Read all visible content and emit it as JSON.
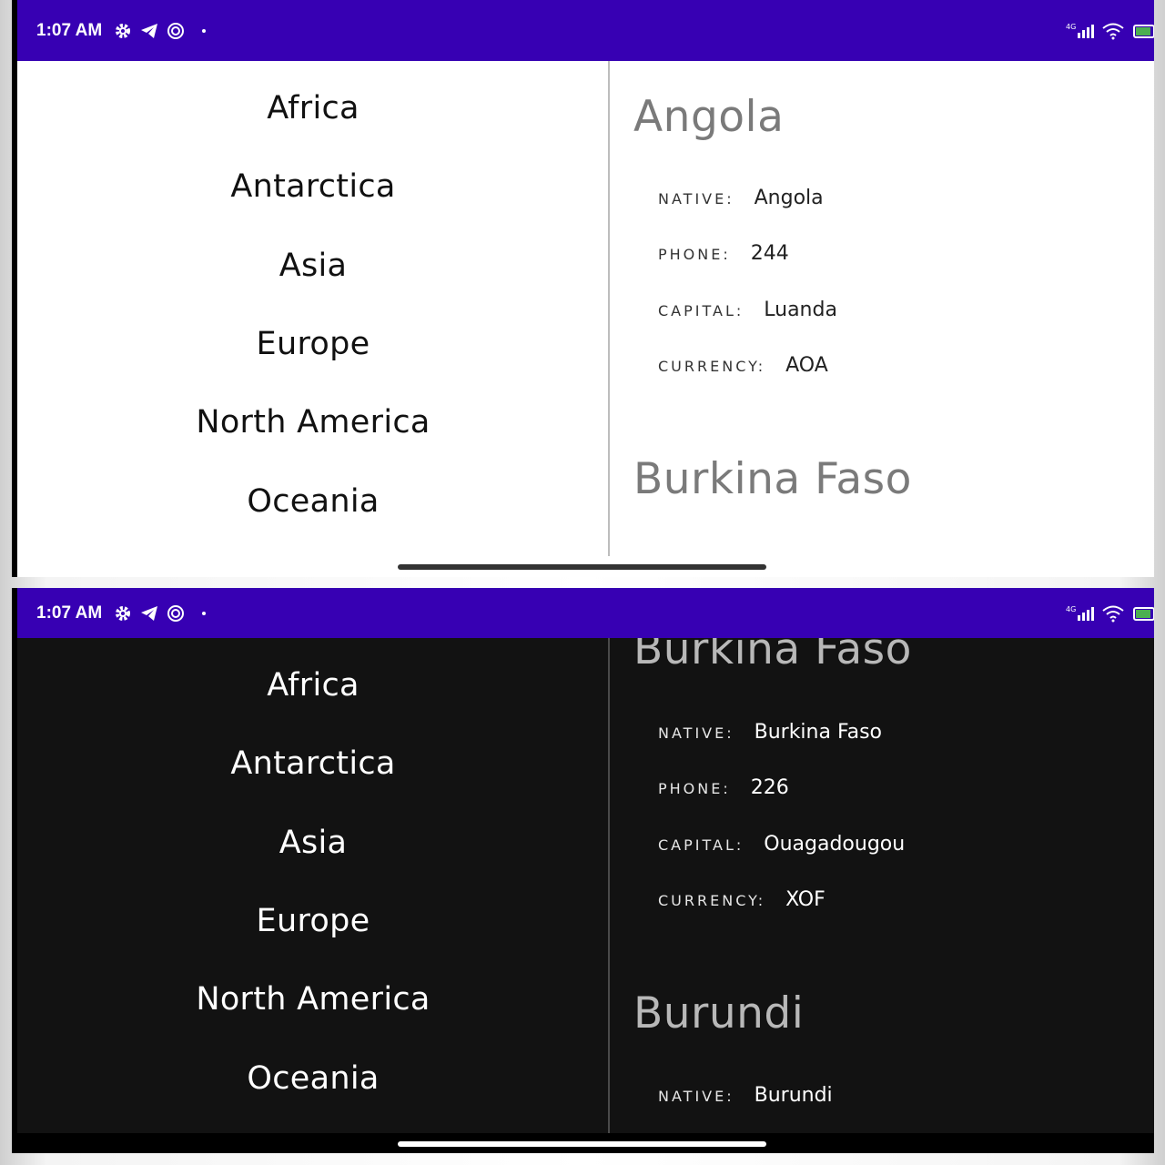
{
  "status_bar": {
    "time": "1:07 AM",
    "network": "4G"
  },
  "continents": [
    "Africa",
    "Antarctica",
    "Asia",
    "Europe",
    "North America",
    "Oceania"
  ],
  "field_labels": {
    "native": "NATIVE:",
    "phone": "PHONE:",
    "capital": "CAPITAL:",
    "currency": "CURRENCY:"
  },
  "light_screen": {
    "countries": [
      {
        "name": "Angola",
        "native": "Angola",
        "phone": "244",
        "capital": "Luanda",
        "currency": "AOA"
      },
      {
        "name": "Burkina Faso"
      }
    ]
  },
  "dark_screen": {
    "countries": [
      {
        "name": "Burkina Faso",
        "native": "Burkina Faso",
        "phone": "226",
        "capital": "Ouagadougou",
        "currency": "XOF"
      },
      {
        "name": "Burundi",
        "native": "Burundi"
      }
    ]
  },
  "colors": {
    "status_bar": "#3700b3",
    "light_background": "#ffffff",
    "dark_background": "#121212"
  }
}
